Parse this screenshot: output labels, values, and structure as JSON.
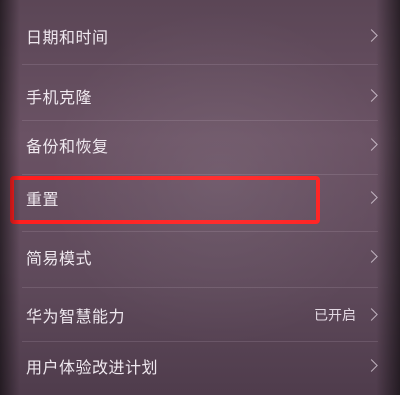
{
  "settings": {
    "items": [
      {
        "label": "日期和时间",
        "value": ""
      },
      {
        "label": "手机克隆",
        "value": ""
      },
      {
        "label": "备份和恢复",
        "value": ""
      },
      {
        "label": "重置",
        "value": ""
      },
      {
        "label": "简易模式",
        "value": ""
      },
      {
        "label": "华为智慧能力",
        "value": "已开启"
      },
      {
        "label": "用户体验改进计划",
        "value": ""
      }
    ]
  },
  "annotation": {
    "highlight_color": "#ff1f1f",
    "highlighted_item": "重置"
  },
  "colors": {
    "background": "#5f4a5b",
    "text": "#efe8ef"
  },
  "icons": {
    "row_chevron": "chevron-right-icon"
  }
}
